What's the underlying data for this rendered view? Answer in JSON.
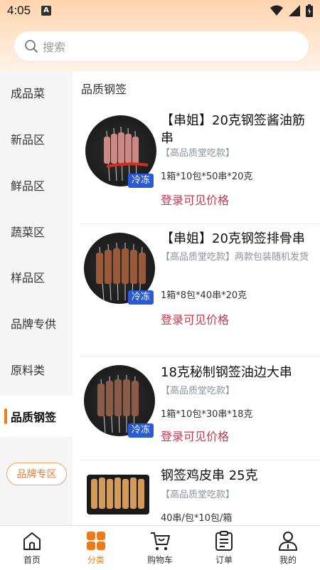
{
  "status": {
    "time": "4:05",
    "notif_badge": "A"
  },
  "search": {
    "placeholder": "搜索"
  },
  "sidebar": {
    "items": [
      {
        "label": "成品菜"
      },
      {
        "label": "新品区"
      },
      {
        "label": "鲜品区"
      },
      {
        "label": "蔬菜区"
      },
      {
        "label": "样品区"
      },
      {
        "label": "品牌专供"
      },
      {
        "label": "原料类"
      },
      {
        "label": "品质钢签",
        "active": true
      }
    ],
    "brand_button": "品牌专区"
  },
  "section": {
    "title": "品质钢签"
  },
  "products": [
    {
      "title": "【串姐】20克钢签酱油筋串",
      "subtitle": "【高品质堂吃款】",
      "spec": "1箱*10包*50串*20克",
      "price": "登录可见价格",
      "badge": "冷冻"
    },
    {
      "title": "【串姐】20克钢签排骨串",
      "subtitle": "【高品质堂吃款】两款包装随机发货",
      "spec": "1箱*8包*40串*20克",
      "price": "登录可见价格",
      "badge": "冷冻"
    },
    {
      "title": "18克秘制钢签油边大串",
      "subtitle": "【高品质堂吃款】",
      "spec": "1箱*10包*30串*18克",
      "price": "登录可见价格",
      "badge": "冷冻"
    },
    {
      "title": "钢签鸡皮串 25克",
      "subtitle": "【高品质堂吃款】",
      "spec": "40串/包*10包/箱",
      "price": "",
      "badge": ""
    }
  ],
  "tabbar": {
    "items": [
      {
        "label": "首页",
        "icon": "home-icon"
      },
      {
        "label": "分类",
        "icon": "category-icon",
        "active": true
      },
      {
        "label": "购物车",
        "icon": "cart-icon"
      },
      {
        "label": "订单",
        "icon": "order-icon"
      },
      {
        "label": "我的",
        "icon": "profile-icon"
      }
    ]
  },
  "colors": {
    "accent": "#f07b16",
    "price": "#d1344a",
    "badge": "#2a5bd6",
    "subtitle": "#8a93a8"
  }
}
